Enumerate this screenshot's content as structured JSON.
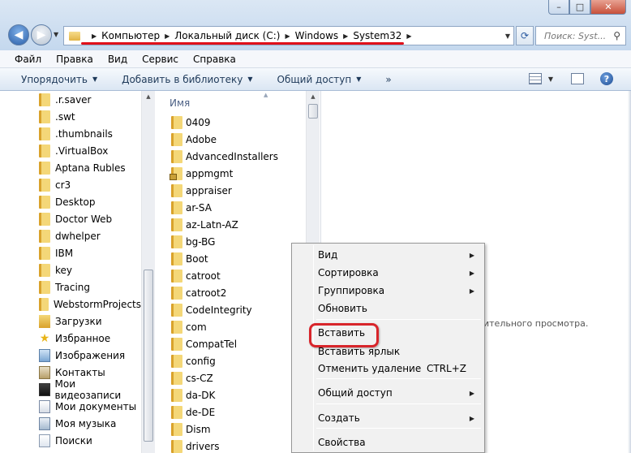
{
  "window": {
    "controls": {
      "minimize": "–",
      "maximize": "□",
      "close": "✕"
    }
  },
  "navigation": {
    "back_glyph": "◀",
    "forward_glyph": "▶",
    "breadcrumb": [
      "Компьютер",
      "Локальный диск (C:)",
      "Windows",
      "System32"
    ],
    "search_placeholder": "Поиск: Syst...",
    "annotation_color": "#e0101a"
  },
  "menubar": [
    "Файл",
    "Правка",
    "Вид",
    "Сервис",
    "Справка"
  ],
  "commandbar": {
    "organize": "Упорядочить",
    "add_to_library": "Добавить в библиотеку",
    "share": "Общий доступ",
    "more": "»"
  },
  "tree": [
    {
      "label": ".r.saver",
      "icon": "folder-icon"
    },
    {
      "label": ".swt",
      "icon": "folder-icon"
    },
    {
      "label": ".thumbnails",
      "icon": "folder-icon"
    },
    {
      "label": ".VirtualBox",
      "icon": "folder-icon"
    },
    {
      "label": "Aptana Rubles",
      "icon": "folder-icon"
    },
    {
      "label": "cr3",
      "icon": "folder-icon"
    },
    {
      "label": "Desktop",
      "icon": "folder-icon"
    },
    {
      "label": "Doctor Web",
      "icon": "folder-icon"
    },
    {
      "label": "dwhelper",
      "icon": "folder-icon"
    },
    {
      "label": "IBM",
      "icon": "folder-icon"
    },
    {
      "label": "key",
      "icon": "folder-icon"
    },
    {
      "label": "Tracing",
      "icon": "folder-icon"
    },
    {
      "label": "WebstormProjects",
      "icon": "folder-icon"
    },
    {
      "label": "Загрузки",
      "icon": "downloads-icon"
    },
    {
      "label": "Избранное",
      "icon": "favorites-star-icon"
    },
    {
      "label": "Изображения",
      "icon": "pictures-icon"
    },
    {
      "label": "Контакты",
      "icon": "contacts-icon"
    },
    {
      "label": "Мои видеозаписи",
      "icon": "videos-icon"
    },
    {
      "label": "Мои документы",
      "icon": "documents-icon"
    },
    {
      "label": "Моя музыка",
      "icon": "music-icon"
    },
    {
      "label": "Поиски",
      "icon": "searches-icon"
    }
  ],
  "files": {
    "column_header": "Имя",
    "items": [
      "0409",
      "Adobe",
      "AdvancedInstallers",
      "appmgmt",
      "appraiser",
      "ar-SA",
      "az-Latn-AZ",
      "bg-BG",
      "Boot",
      "catroot",
      "catroot2",
      "CodeIntegrity",
      "com",
      "CompatTel",
      "config",
      "cs-CZ",
      "da-DK",
      "de-DE",
      "Dism",
      "drivers"
    ],
    "locked_item": "appmgmt"
  },
  "preview": {
    "partial_text": "ительного просмотра."
  },
  "context_menu": {
    "items": [
      {
        "label": "Вид",
        "submenu": true
      },
      {
        "label": "Сортировка",
        "submenu": true
      },
      {
        "label": "Группировка",
        "submenu": true
      },
      {
        "label": "Обновить"
      },
      {
        "label": "Вставить"
      },
      {
        "label": "Вставить ярлык"
      },
      {
        "label": "Отменить удаление",
        "shortcut": "CTRL+Z"
      },
      {
        "label": "Общий доступ",
        "submenu": true
      },
      {
        "label": "Создать",
        "submenu": true
      },
      {
        "label": "Свойства"
      }
    ],
    "highlighted": "Вставить",
    "highlight_color": "#d8252b"
  }
}
